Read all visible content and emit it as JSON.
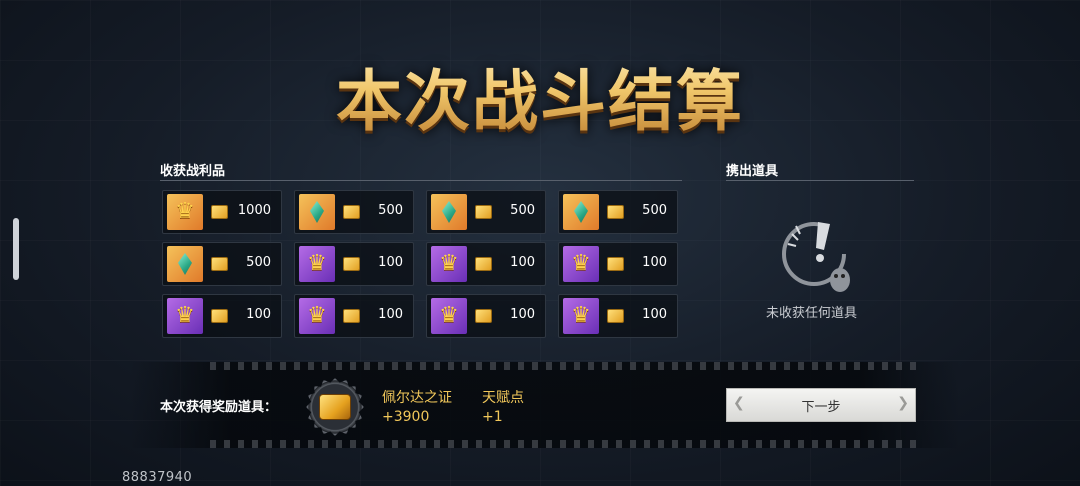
{
  "title": "本次战斗结算",
  "loot": {
    "label": "收获战利品",
    "items": [
      {
        "icon": "crown-icon",
        "bg": "gold",
        "qty": "1000"
      },
      {
        "icon": "gem-icon",
        "bg": "gold",
        "qty": "500"
      },
      {
        "icon": "gem-icon",
        "bg": "gold",
        "qty": "500"
      },
      {
        "icon": "gem-icon",
        "bg": "gold",
        "qty": "500"
      },
      {
        "icon": "gem-icon",
        "bg": "gold",
        "qty": "500"
      },
      {
        "icon": "crown-icon",
        "bg": "purple",
        "qty": "100"
      },
      {
        "icon": "crown-icon",
        "bg": "purple",
        "qty": "100"
      },
      {
        "icon": "crown-icon",
        "bg": "purple",
        "qty": "100"
      },
      {
        "icon": "crown-icon",
        "bg": "purple",
        "qty": "100"
      },
      {
        "icon": "crown-icon",
        "bg": "purple",
        "qty": "100"
      },
      {
        "icon": "crown-icon",
        "bg": "purple",
        "qty": "100"
      },
      {
        "icon": "crown-icon",
        "bg": "purple",
        "qty": "100"
      }
    ]
  },
  "discard": {
    "label": "携出道具",
    "empty_text": "未收获任何道具"
  },
  "rewards": {
    "label": "本次获得奖励道具：",
    "items": [
      {
        "name": "佩尔达之证",
        "value": "+3900"
      },
      {
        "name": "天赋点",
        "value": "+1"
      }
    ]
  },
  "next_button": "下一步",
  "footer_id": "88837940"
}
